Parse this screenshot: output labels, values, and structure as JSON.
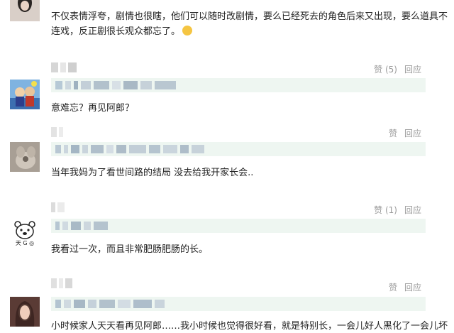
{
  "comments": [
    {
      "text_line1": "不仅表情浮夸，剧情也很瞎，他们可以随时改剧情，要么已经死去的角色后来又出现，要么道具不",
      "text_line2": "连戏，反正剧很长观众都忘了。",
      "emoji": "grinning-sweat-emoji"
    },
    {
      "like_label": "赞 (5)",
      "reply_label": "回应",
      "text": "意难忘？再见阿郎？"
    },
    {
      "like_label": "赞",
      "reply_label": "回应",
      "text": "当年我妈为了看世间路的结局 没去给我开家长会.."
    },
    {
      "like_label": "赞 (1)",
      "reply_label": "回应",
      "avatar_caption": "天 G ◎",
      "text": "我看过一次，而且非常肥肠肥肠的长。"
    },
    {
      "like_label": "赞",
      "reply_label": "回应",
      "text": "小时候家人天天看再见阿郎……我小时候也觉得很好看，就是特别长，一会儿好人黑化了一会儿坏"
    }
  ]
}
